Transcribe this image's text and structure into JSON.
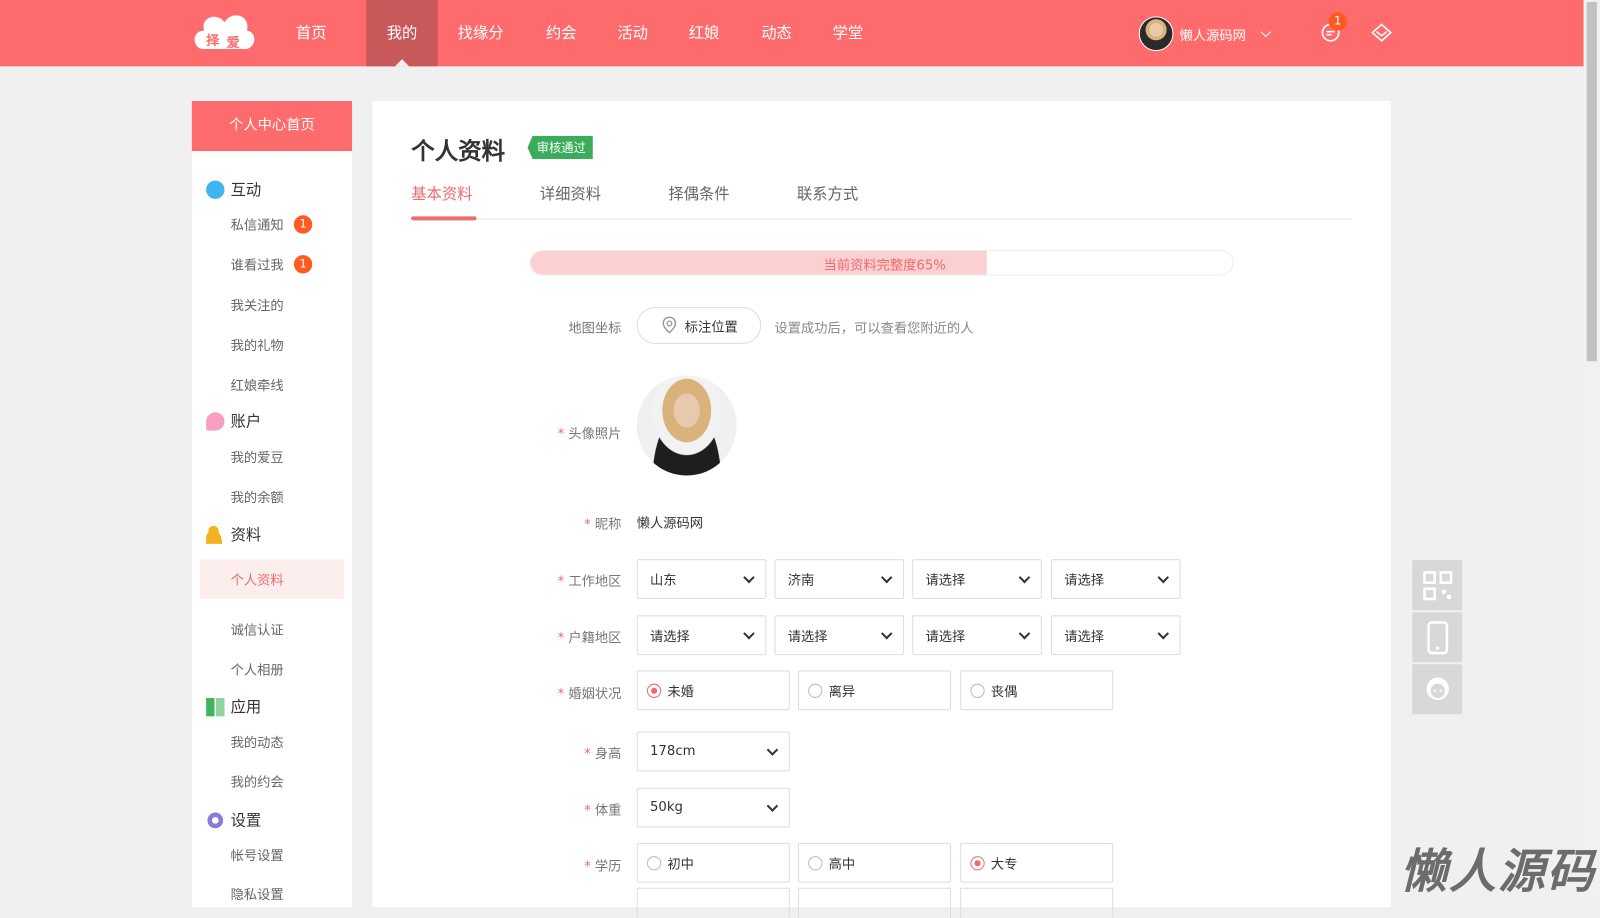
{
  "header": {
    "logo_text": "择爱",
    "nav": [
      "首页",
      "我的",
      "找缘分",
      "约会",
      "活动",
      "红娘",
      "动态",
      "学堂"
    ],
    "active_nav": "我的",
    "username": "懒人源码网",
    "message_count": "1",
    "accent": "#fd6b6c"
  },
  "sidebar": {
    "home": "个人中心首页",
    "groups": [
      {
        "title": "互动",
        "items": [
          {
            "label": "私信通知",
            "badge": "1"
          },
          {
            "label": "谁看过我",
            "badge": "1"
          },
          {
            "label": "我关注的"
          },
          {
            "label": "我的礼物"
          },
          {
            "label": "红娘牵线"
          }
        ]
      },
      {
        "title": "账户",
        "items": [
          {
            "label": "我的爱豆"
          },
          {
            "label": "我的余额"
          }
        ]
      },
      {
        "title": "资料",
        "items": [
          {
            "label": "个人资料"
          },
          {
            "label": "诚信认证"
          },
          {
            "label": "个人相册"
          }
        ]
      },
      {
        "title": "应用",
        "items": [
          {
            "label": "我的动态"
          },
          {
            "label": "我的约会"
          }
        ]
      },
      {
        "title": "设置",
        "items": [
          {
            "label": "帐号设置"
          },
          {
            "label": "隐私设置"
          }
        ]
      }
    ]
  },
  "main": {
    "title": "个人资料",
    "status": "审核通过",
    "tabs": [
      "基本资料",
      "详细资料",
      "择偶条件",
      "联系方式"
    ],
    "progress_text": "当前资料完整度65%",
    "progress": 65,
    "map": {
      "label": "地图坐标",
      "button": "标注位置",
      "hint": "设置成功后，可以查看您附近的人"
    },
    "avatar_label": "头像照片",
    "nickname": {
      "label": "昵称",
      "value": "懒人源码网"
    },
    "work_area": {
      "label": "工作地区",
      "values": [
        "山东",
        "济南",
        "请选择",
        "请选择"
      ]
    },
    "hukou": {
      "label": "户籍地区",
      "values": [
        "请选择",
        "请选择",
        "请选择",
        "请选择"
      ]
    },
    "marital": {
      "label": "婚姻状况",
      "options": [
        "未婚",
        "离异",
        "丧偶"
      ],
      "selected": 0
    },
    "height": {
      "label": "身高",
      "value": "178cm"
    },
    "weight": {
      "label": "体重",
      "value": "50kg"
    },
    "education": {
      "label": "学历",
      "options": [
        "初中",
        "高中",
        "大专"
      ],
      "selected": 2
    },
    "required_mark": "*"
  },
  "watermark": "懒人源码"
}
